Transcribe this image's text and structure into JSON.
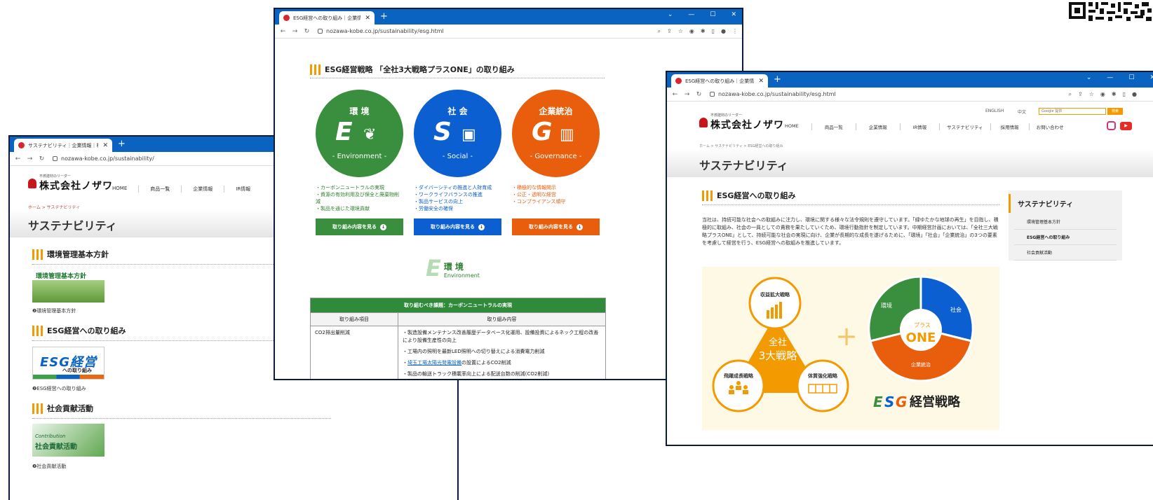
{
  "left": {
    "tab_title": "サステナビリティ｜企業情報｜株式会",
    "url": "nozawa-kobe.co.jp/sustainability/",
    "logo_small": "不燃建材のリーダー",
    "logo_big": "株式会社ノザワ",
    "nav": [
      "HOME",
      "商品一覧",
      "企業情報",
      "IR情報"
    ],
    "breadcrumb": "ホーム > サステナビリティ",
    "page_title": "サステナビリティ",
    "sections": [
      {
        "heading": "環境管理基本方針",
        "thumb_label": "環境管理基本方針",
        "caption": "❷環境管理基本方針"
      },
      {
        "heading": "ESG経営への取り組み",
        "thumb_big": "ESG経営",
        "thumb_sub": "への取り組み",
        "caption": "❷ESG経営への取り組み"
      },
      {
        "heading": "社会貢献活動",
        "thumb_en": "Contribution",
        "thumb_jp": "社会貢献活動",
        "caption": "❷社会貢献活動"
      }
    ]
  },
  "center": {
    "tab_title": "ESG経営への取り組み｜企業情報",
    "url": "nozawa-kobe.co.jp/sustainability/esg.html",
    "title": "ESG経営戦略 「全社3大戦略プラスONE」の取り組み",
    "pillars": [
      {
        "jp": "環 境",
        "letter": "E",
        "en": "- Environment -",
        "color": "#3a8f3f",
        "items": [
          "・カーボンニュートラルの実現",
          "・資源の有効利用及び保全と廃棄物削減",
          "・製品を通じた環境貢献"
        ],
        "button": "取り組み内容を見る"
      },
      {
        "jp": "社 会",
        "letter": "S",
        "en": "- Social -",
        "color": "#0b5fd0",
        "items": [
          "・ダイバーシティの推進と人財育成",
          "・ワークライフバランスの推進",
          "・製品サービスの向上",
          "・労働安全の確保"
        ],
        "button": "取り組み内容を見る"
      },
      {
        "jp": "企業統治",
        "letter": "G",
        "en": "- Governance -",
        "color": "#e85e0c",
        "items": [
          "・積極的な情報開示",
          "・公正・透明な経営",
          "・コンプライアンス順守"
        ],
        "button": "取り組み内容を見る"
      }
    ],
    "e_section": {
      "letter": "E",
      "jp": "環 境",
      "en": "Environment"
    },
    "table": {
      "caption": "取り組むべき課題：カーボンニュートラルの実現",
      "headers": [
        "取り組み項目",
        "取り組み内容"
      ],
      "item": "CO2排出量削減",
      "contents": [
        "・製造設備メンテナンス改善履歴データベース化運用、設備投資によるネック工程の改善により設備生産性の向上",
        "・工場内の照明を最新LED照明への切り替えによる消費電力削減"
      ],
      "link_text": "埼玉工場太陽光発電設備",
      "link_after": "の設置によるCO2削減",
      "cut_row": "・製品の輸送トラック積載率向上による配送台数の削減(CO2削減)"
    }
  },
  "right": {
    "tab_title": "ESG経営への取り組み｜企業情報",
    "url": "nozawa-kobe.co.jp/sustainability/esg.html",
    "top_links": [
      "ENGLISH",
      "中文"
    ],
    "search_placeholder": "Google 提供",
    "search_button": "検索",
    "nav": [
      "HOME",
      "商品一覧",
      "企業情報",
      "IR情報",
      "サステナビリティ",
      "採用情報",
      "お問い合わせ"
    ],
    "breadcrumb": "ホーム > サステナビリティ > ESG経営への取り組み",
    "page_title": "サステナビリティ",
    "heading": "ESG経営への取り組み",
    "body": "当社は、持続可能な社会への取組みに注力し、環境に関する様々な法令規則を遵守しています。「緑ゆたかな地球の再生」を目指し、積極的に取組み、社会の一員としての責務を果たしていくため、環境行動指針を制定しています。中期経営計画においては、「全社三大戦略プラスONE」として、持続可能な社会の実現に向け、企業が長期的な成長を遂げるために、「環境」「社会」「企業統治」の3つの要素を考慮して経営を行う、ESG経営への取組みを推進しています。",
    "sidebar": {
      "title": "サステナビリティ",
      "items": [
        "環境管理基本方針",
        "ESG経営への取り組み",
        "社会貢献活動"
      ],
      "active": 1
    },
    "figure": {
      "top": "収益拡大戦略",
      "left": "飛躍成長戦略",
      "right": "体質強化戦略",
      "center_1": "全社",
      "center_2": "3大戦略",
      "plus": "+",
      "pie_env": "環境",
      "pie_soc": "社会",
      "pie_gov": "企業統治",
      "pie_center_1": "プラス",
      "pie_center_2": "ONE",
      "esg_e": "E",
      "esg_s": "S",
      "esg_g": "G",
      "esg_rest": "経営戦略"
    }
  }
}
